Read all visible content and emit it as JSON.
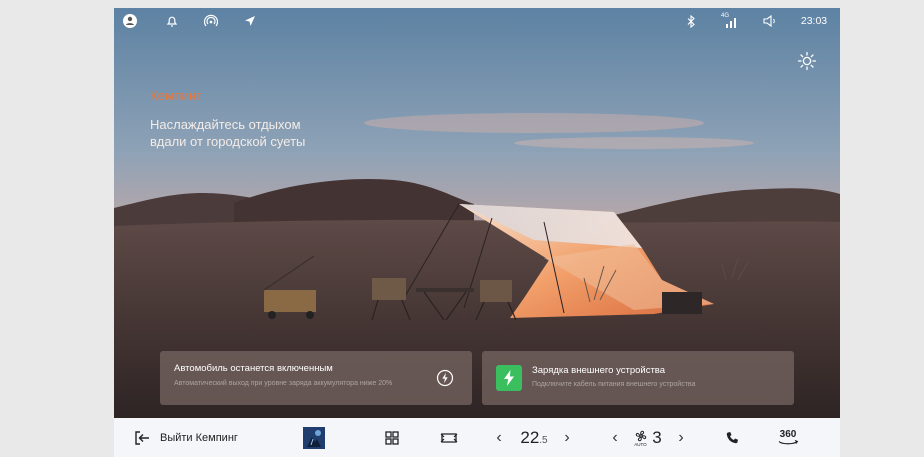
{
  "status_bar": {
    "time": "23:03",
    "signal_label": "4G",
    "left_icons": [
      "profile-icon",
      "bell-icon",
      "hotspot-icon",
      "navigation-arrow-icon"
    ],
    "right_icons": [
      "bluetooth-icon",
      "signal-icon",
      "volume-icon"
    ]
  },
  "hero": {
    "title": "Кемпинг",
    "text": "Наслаждайтесь отдыхом вдали от городской суеты"
  },
  "cards": {
    "power": {
      "title": "Автомобиль останется включенным",
      "subtitle": "Автоматический выход при уровне заряда аккумулятора ниже 20%",
      "icon": "power-bolt-icon"
    },
    "charging": {
      "title": "Зарядка внешнего устройства",
      "subtitle": "Подключите кабель питания внешнего устройства",
      "icon": "charging-bolt-icon",
      "accent": "#3bbf5e"
    }
  },
  "dock": {
    "exit_label": "Выйти Кемпинг",
    "temperature_int": "22",
    "temperature_dec": ".5",
    "fan_level": "3",
    "fan_mode": "AUTO",
    "view_360_label": "360"
  },
  "colors": {
    "hero_title": "#e9773a",
    "dock_bg": "#f4f6fa"
  }
}
